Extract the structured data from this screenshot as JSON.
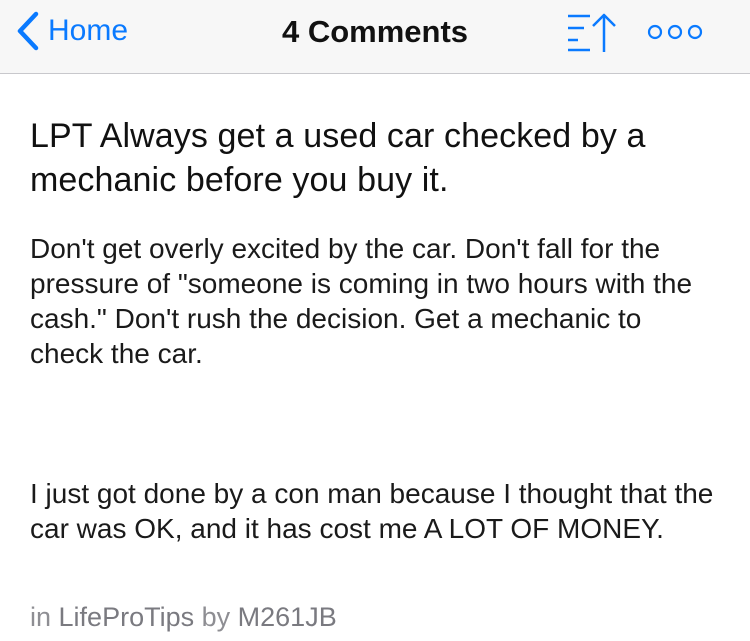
{
  "navbar": {
    "back_label": "Home",
    "title": "4 Comments",
    "accent_color": "#0a7aff",
    "icons": {
      "back": "chevron-left-icon",
      "sort": "sort-up-icon",
      "more": "more-dots-icon"
    }
  },
  "post": {
    "title": "LPT Always get a used car checked by a mechanic before you buy it.",
    "paragraphs": [
      "Don't get overly excited by the car. Don't fall for the pressure of \"someone is coming in two hours with the cash.\" Don't rush the decision. Get a mechanic to check the car.",
      "I just got done by a con man because I thought that the car was OK, and it has cost me A LOT OF MONEY."
    ],
    "meta": {
      "in_prefix": "in",
      "subreddit": "LifeProTips",
      "by_prefix": "by",
      "author": "M261JB"
    }
  }
}
